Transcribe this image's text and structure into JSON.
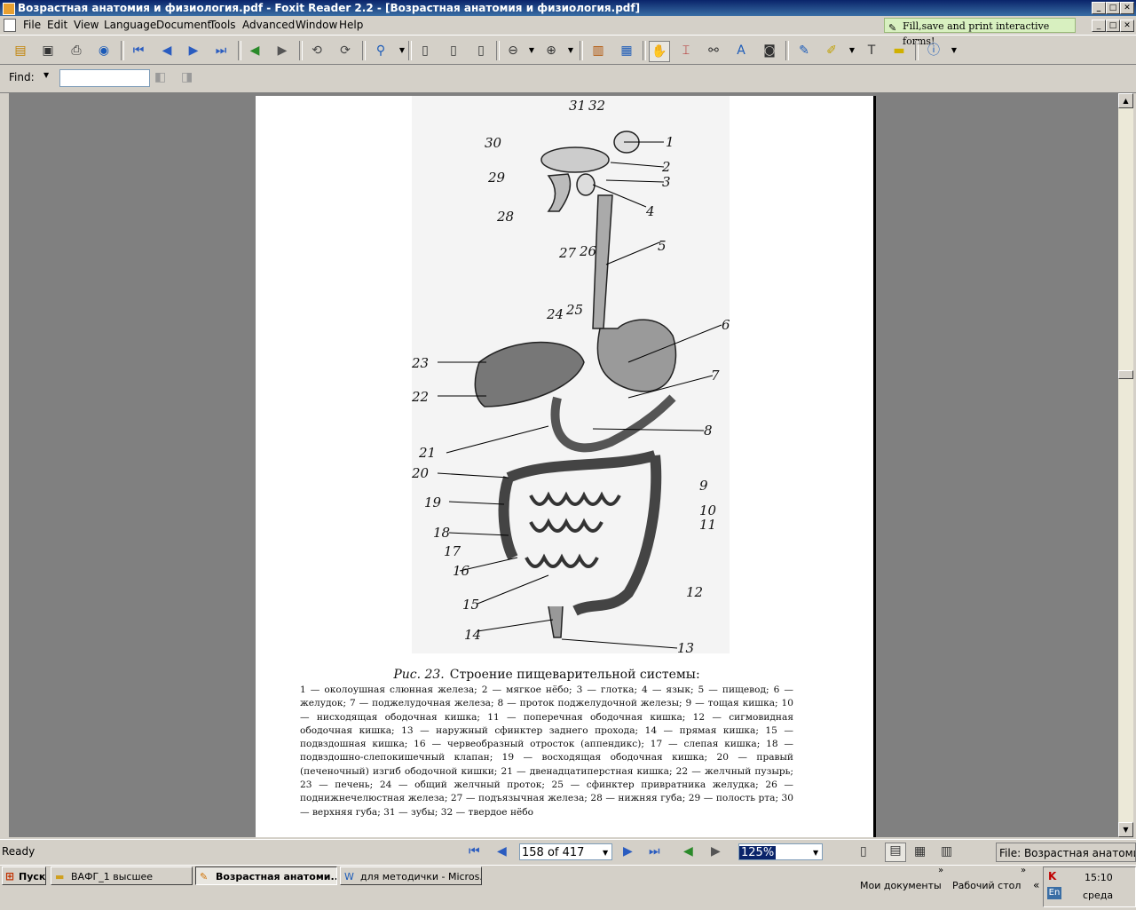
{
  "window": {
    "title": "Возрастная анатомия и физиология.pdf - Foxit Reader 2.2 - [Возрастная анатомия и физиология.pdf]"
  },
  "menubar": {
    "items": [
      "File",
      "Edit",
      "View",
      "Language",
      "Document",
      "Tools",
      "Advanced",
      "Window",
      "Help"
    ],
    "promo": "Fill,save and print interactive forms!"
  },
  "findbar": {
    "label": "Find:",
    "value": ""
  },
  "document": {
    "figure_labels": [
      "1",
      "2",
      "3",
      "4",
      "5",
      "6",
      "7",
      "8",
      "9",
      "10",
      "11",
      "12",
      "13",
      "14",
      "15",
      "16",
      "17",
      "18",
      "19",
      "20",
      "21",
      "22",
      "23",
      "24",
      "25",
      "26",
      "27",
      "28",
      "29",
      "30",
      "31",
      "32"
    ],
    "caption_title_ref": "Рис. 23.",
    "caption_title": "Строение пищеварительной системы:",
    "caption_body": "1 — околоушная слюнная железа; 2 — мягкое нёбо; 3 — глотка; 4 — язык; 5 — пищевод; 6 — желудок; 7 — поджелудочная железа; 8 — проток поджелудочной железы; 9 — тощая кишка; 10 — нисходящая ободочная кишка; 11 — поперечная ободочная кишка; 12 — сигмовидная ободочная кишка; 13 — наружный сфинктер заднего прохода; 14 — прямая кишка; 15 — подвздошная кишка; 16 — червеобразный отросток (аппендикс); 17 — слепая кишка; 18 — подвздошно-слепокишечный клапан; 19 — восходящая ободочная кишка; 20 — правый (печеночный) изгиб ободочной кишки; 21 — двенадцатиперстная кишка; 22 — желчный пузырь; 23 — печень; 24 — общий желчный проток; 25 — сфинктер привратника желудка; 26 — поднижнечелюстная железа; 27 — подъязычная железа; 28 — нижняя губа; 29 — полость рта; 30 — верхняя губа; 31 — зубы; 32 — твердое нёбо"
  },
  "statusbar": {
    "status": "Ready",
    "page": "158 of 417",
    "zoom": "125%",
    "file": "File: Возрастная анатомия и физиология.pdf"
  },
  "taskbar": {
    "start": "Пуск",
    "buttons": [
      "ВАФГ_1 высшее",
      "Возрастная анатоми...",
      "для методички - Micros..."
    ],
    "quicklinks": [
      "Мои документы",
      "Рабочий стол"
    ],
    "lang": "En",
    "time": "15:10",
    "day": "среда"
  },
  "colors": {
    "titlebar": "#0a246a",
    "docbg": "#808080",
    "chrome": "#d4d0c8",
    "promo": "#d8f0c0"
  },
  "icons": [
    "open-icon",
    "save-icon",
    "print-icon",
    "email-icon",
    "first-page-icon",
    "prev-page-icon",
    "next-page-icon",
    "last-page-icon",
    "back-icon",
    "forward-icon",
    "zoom-icon",
    "hand-icon",
    "text-select-icon",
    "note-icon",
    "info-icon"
  ]
}
